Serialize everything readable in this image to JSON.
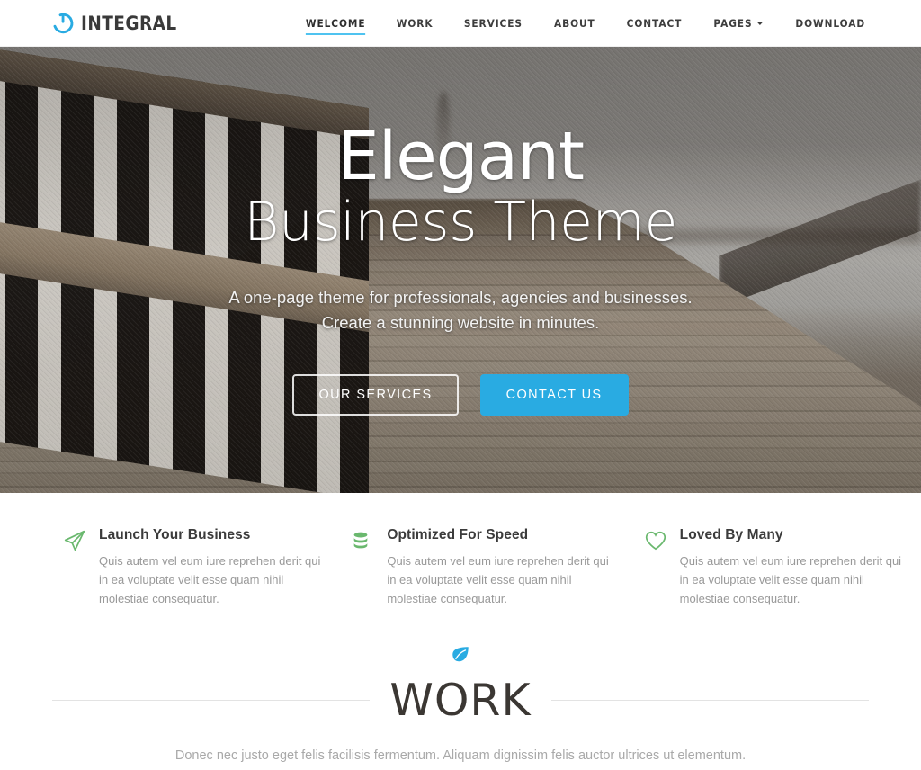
{
  "navbar": {
    "brand": {
      "icon": "power-icon",
      "text": "INTEGRAL",
      "color": "#29abe2"
    },
    "links": [
      {
        "label": "WELCOME",
        "active": true
      },
      {
        "label": "WORK",
        "active": false
      },
      {
        "label": "SERVICES",
        "active": false
      },
      {
        "label": "ABOUT",
        "active": false
      },
      {
        "label": "CONTACT",
        "active": false
      },
      {
        "label": "PAGES",
        "active": false,
        "has_dropdown": true
      },
      {
        "label": "DOWNLOAD",
        "active": false
      }
    ],
    "active_underline_color": "#4fc3f0"
  },
  "hero": {
    "title_line1": "Elegant",
    "title_line2": "Business Theme",
    "subtitle_line1": "A one-page theme for professionals, agencies and businesses.",
    "subtitle_line2": "Create a stunning website in minutes.",
    "buttons": [
      {
        "label": "OUR SERVICES",
        "style": "ghost"
      },
      {
        "label": "CONTACT US",
        "style": "primary",
        "color": "#29abe2"
      }
    ],
    "background": "blurred wooden pier with railing over water"
  },
  "features": [
    {
      "icon": "paper-plane-icon",
      "icon_color": "#6ab86e",
      "title": "Launch Your Business",
      "text": "Quis autem vel eum iure reprehen derit qui in ea voluptate velit esse quam nihil molestiae consequatur."
    },
    {
      "icon": "database-icon",
      "icon_color": "#6ab86e",
      "title": "Optimized For Speed",
      "text": "Quis autem vel eum iure reprehen derit qui in ea voluptate velit esse quam nihil molestiae consequatur."
    },
    {
      "icon": "heart-icon",
      "icon_color": "#6ab86e",
      "title": "Loved By Many",
      "text": "Quis autem vel eum iure reprehen derit qui in ea voluptate velit esse quam nihil molestiae consequatur."
    }
  ],
  "work_section": {
    "ornament_icon": "leaf-icon",
    "ornament_color": "#29abe2",
    "title": "WORK",
    "subtitle": "Donec nec justo eget felis facilisis fermentum. Aliquam dignissim felis auctor ultrices ut elementum."
  }
}
